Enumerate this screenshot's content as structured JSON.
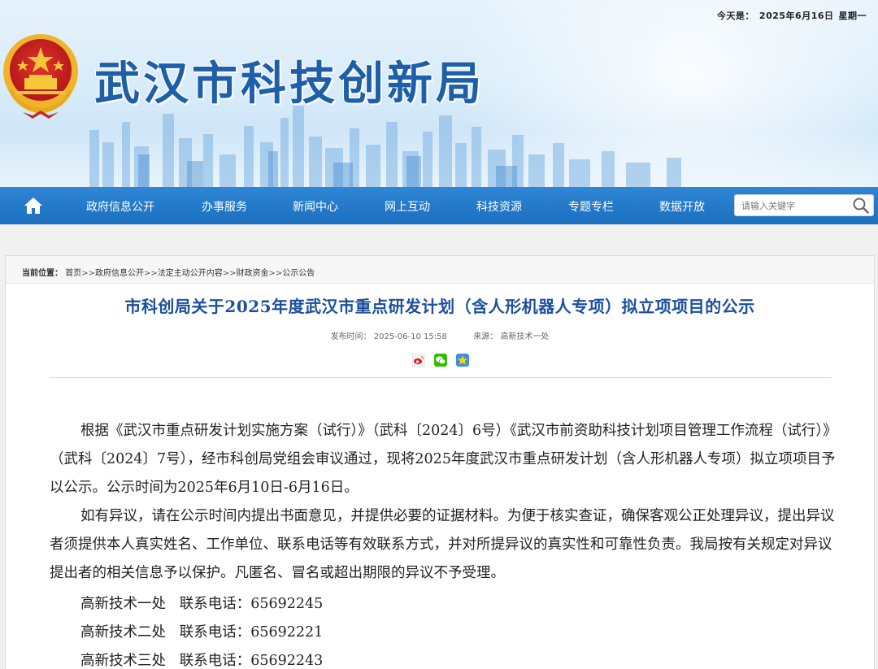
{
  "header": {
    "date_label": "今天是：",
    "date_value": "2025年6月16日",
    "weekday": "星期一",
    "site_title": "武汉市科技创新局"
  },
  "nav": {
    "items": [
      "政府信息公开",
      "办事服务",
      "新闻中心",
      "网上互动",
      "科技资源",
      "专题专栏",
      "数据开放"
    ],
    "search_placeholder": "请输入关键字"
  },
  "breadcrumb": {
    "label": "当前位置：",
    "items": [
      "首页",
      "政府信息公开",
      "法定主动公开内容",
      "财政资金",
      "公示公告"
    ],
    "separator": ">>"
  },
  "article": {
    "title": "市科创局关于2025年度武汉市重点研发计划（含人形机器人专项）拟立项项目的公示",
    "publish_label": "发布时间：",
    "publish_time": "2025-06-10 15:58",
    "source_label": "来源：",
    "source": "高新技术一处",
    "share_icons": [
      "weibo-icon",
      "wechat-icon",
      "qzone-icon"
    ],
    "paragraphs": [
      "根据《武汉市重点研发计划实施方案（试行）》（武科〔2024〕6号）《武汉市前资助科技计划项目管理工作流程（试行）》（武科〔2024〕7号），经市科创局党组会审议通过，现将2025年度武汉市重点研发计划（含人形机器人专项）拟立项项目予以公示。公示时间为2025年6月10日-6月16日。",
      "如有异议，请在公示时间内提出书面意见，并提供必要的证据材料。为便于核实查证，确保客观公正处理异议，提出异议者须提供本人真实姓名、工作单位、联系电话等有效联系方式，并对所提异议的真实性和可靠性负责。我局按有关规定对异议提出者的相关信息予以保护。凡匿名、冒名或超出期限的异议不予受理。"
    ],
    "contacts": [
      {
        "dept": "高新技术一处",
        "label": "联系电话：",
        "phone": "65692245"
      },
      {
        "dept": "高新技术二处",
        "label": "联系电话：",
        "phone": "65692221"
      },
      {
        "dept": "高新技术三处",
        "label": "联系电话：",
        "phone": "65692243"
      }
    ]
  },
  "colors": {
    "nav_blue": "#1a6fbf",
    "title_blue": "#1d5fa8",
    "article_title": "#1c4f9c"
  }
}
